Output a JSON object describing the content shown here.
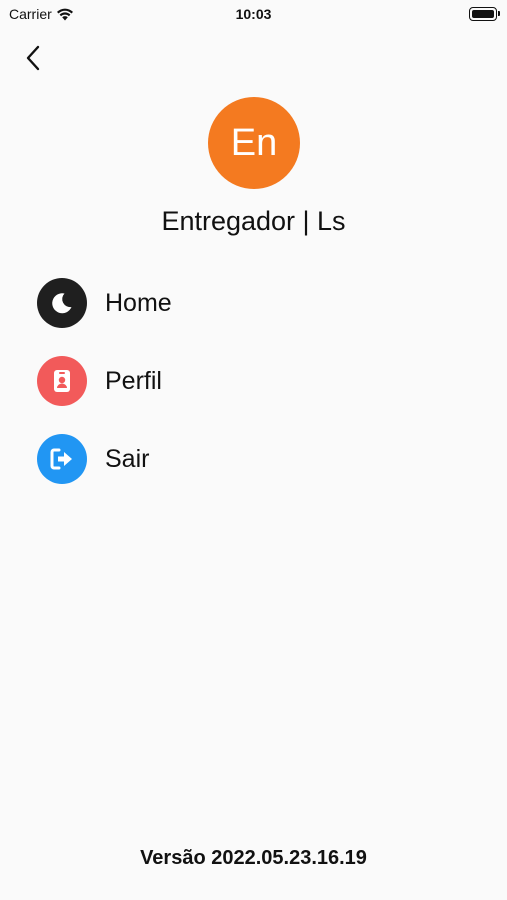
{
  "status_bar": {
    "carrier": "Carrier",
    "time": "10:03"
  },
  "header": {
    "back_icon": "chevron-left-icon"
  },
  "profile": {
    "avatar_initials": "En",
    "avatar_color": "#f47a20",
    "name": "Entregador | Ls"
  },
  "menu": {
    "items": [
      {
        "label": "Home",
        "icon": "moon-icon",
        "color": "#1f1f1f"
      },
      {
        "label": "Perfil",
        "icon": "id-badge-icon",
        "color": "#f25a5a"
      },
      {
        "label": "Sair",
        "icon": "sign-out-icon",
        "color": "#2196f3"
      }
    ]
  },
  "footer": {
    "version": "Versão 2022.05.23.16.19"
  }
}
